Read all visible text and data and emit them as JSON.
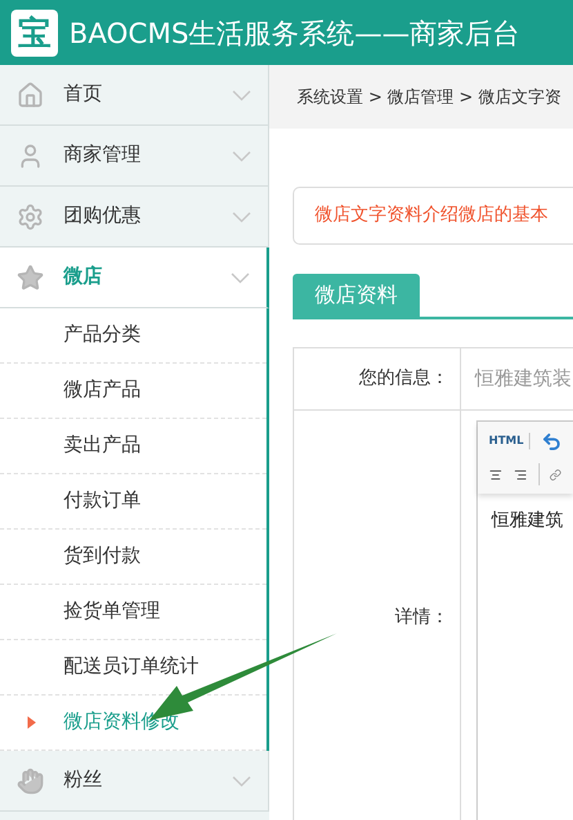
{
  "header": {
    "logo": "宝",
    "title": "BAOCMS生活服务系统——商家后台"
  },
  "sidebar": {
    "items": [
      {
        "label": "首页",
        "expanded": false
      },
      {
        "label": "商家管理",
        "expanded": false
      },
      {
        "label": "团购优惠",
        "expanded": false
      },
      {
        "label": "微店",
        "expanded": true,
        "children": [
          {
            "label": "产品分类",
            "selected": false
          },
          {
            "label": "微店产品",
            "selected": false
          },
          {
            "label": "卖出产品",
            "selected": false
          },
          {
            "label": "付款订单",
            "selected": false
          },
          {
            "label": "货到付款",
            "selected": false
          },
          {
            "label": "捡货单管理",
            "selected": false
          },
          {
            "label": "配送员订单统计",
            "selected": false
          },
          {
            "label": "微店资料修改",
            "selected": true
          }
        ]
      },
      {
        "label": "粉丝",
        "expanded": false
      }
    ]
  },
  "breadcrumb": "系统设置 > 微店管理 > 微店文字资",
  "notice": "微店文字资料介绍微店的基本",
  "tabs": [
    {
      "label": "微店资料",
      "selected": true
    }
  ],
  "form": {
    "rows": [
      {
        "label": "您的信息：",
        "value": "恒雅建筑装"
      },
      {
        "label": "详情：",
        "editor": {
          "html_button": "HTML",
          "content": "恒雅建筑"
        }
      }
    ]
  }
}
